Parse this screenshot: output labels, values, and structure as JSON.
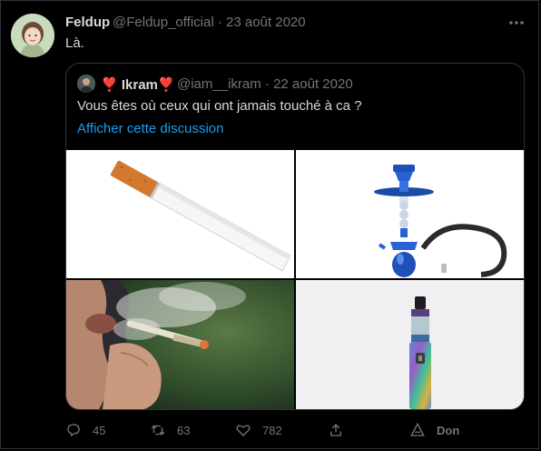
{
  "tweet": {
    "author_name": "Feldup",
    "author_meta": "@Feldup_official · 23 août 2020",
    "text": "Là."
  },
  "quoted": {
    "author_name": "❣️ Ikram❣️",
    "author_meta": "@iam__ikram · 22 août 2020",
    "text": "Vous êtes où ceux qui ont jamais touché à ca ?",
    "link": "Afficher cette discussion",
    "images": [
      "cigarette",
      "hookah",
      "joint-smoking",
      "vape-pen"
    ]
  },
  "actions": {
    "replies": "45",
    "retweets": "63",
    "likes": "782",
    "share": "",
    "donate": "Don"
  },
  "icons": [
    "more-icon",
    "reply-icon",
    "retweet-icon",
    "like-icon",
    "share-icon",
    "donate-icon"
  ],
  "colors": {
    "background": "#000000",
    "link": "#1d9bf0",
    "muted": "#6e767d"
  }
}
